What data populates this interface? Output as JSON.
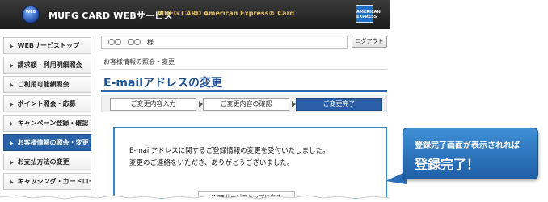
{
  "header": {
    "logo_text": "WEB",
    "brand": "MUFG CARD WEBサービス",
    "brand_sub": "MUFG CARD American Express® Card",
    "amex_logo": "AMERICAN EXPRESS"
  },
  "sidebar": {
    "items": [
      {
        "label": "WEBサービストップ"
      },
      {
        "label": "請求額・利用明細照会"
      },
      {
        "label": "ご利用可能額照会"
      },
      {
        "label": "ポイント照会・応募"
      },
      {
        "label": "キャンペーン登録・確認"
      },
      {
        "label": "お客様情報の照会・変更",
        "active": true
      },
      {
        "label": "お支払方法の変更"
      },
      {
        "label": "キャッシング・カードローン"
      }
    ]
  },
  "main": {
    "user_name": "〇〇　〇〇　様",
    "logout_label": "ログアウト",
    "breadcrumb": "お客様情報の照会・変更",
    "page_title": "E-mailアドレスの変更",
    "steps": [
      {
        "label": "ご変更内容入力"
      },
      {
        "label": "ご変更内容の確認"
      },
      {
        "label": "ご変更完了",
        "current": true
      }
    ],
    "message_line1": "E-mailアドレスに関するご登録情報の変更を受付いたしました。",
    "message_line2": "変更のご連絡をいただき、ありがとうございました。",
    "footer_button": "WEBサービストップに戻る"
  },
  "callout": {
    "line1": "登録完了画面が表示されれば",
    "line2": "登録完了！"
  },
  "colors": {
    "accent": "#2a63a7",
    "title": "#1c4f93",
    "callout": "#2c6fb8"
  }
}
